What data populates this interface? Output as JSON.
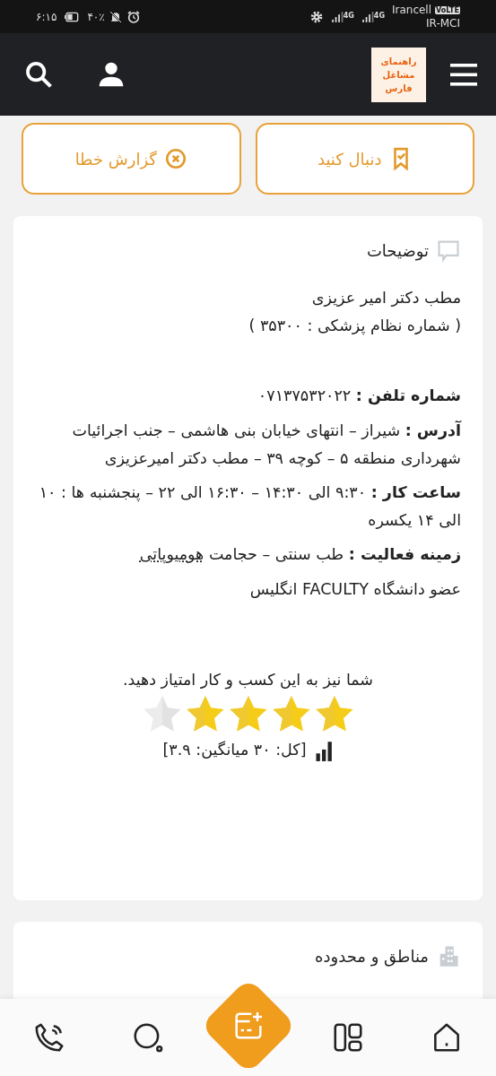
{
  "status_bar": {
    "time": "۶:۱۵",
    "battery": "۴۰٪",
    "volte": "VoLTE",
    "network_1": "4G",
    "network_2": "4G",
    "carrier_1": "Irancell",
    "carrier_2": "IR-MCI"
  },
  "header": {
    "logo_lines": [
      "راهنمای",
      "مشاغل",
      "فارس"
    ]
  },
  "actions": [
    {
      "kind": "follow",
      "label": "دنبال کنید"
    },
    {
      "kind": "report",
      "label": "گزارش خطا"
    }
  ],
  "description": {
    "title": "توضیحات",
    "lines": [
      "مطب دکتر امیر عزیزی",
      "( شماره نظام پزشکی : ۳۵۳۰۰ )"
    ],
    "fields": [
      {
        "text": "**شماره تلفن :** ۰۷۱۳۷۵۳۲۰۲۲"
      },
      {
        "text": "**آدرس :** شیراز – انتهای خیابان بنی هاشمی – جنب اجرائیات شهرداری منطقه ۵ – کوچه ۳۹ – مطب دکتر امیرعزیزی"
      },
      {
        "text": "**ساعت کار :** ۹:۳۰ الی ۱۴:۳۰ – ۱۶:۳۰ الی ۲۲ – پنجشنبه ها : ۱۰ الی ۱۴ یکسره"
      },
      {
        "text": "**زمینه فعالیت :** طب سنتی – حجامت",
        "link": "هومیوپاتی"
      },
      {
        "text": "عضو دانشگاه FACULTY انگلیس"
      }
    ],
    "rating": {
      "prompt": "شما نیز به این کسب و کار امتیاز دهید.",
      "stars": 4,
      "summary": "[کل: ۳۰ میانگین: ۳.۹]"
    }
  },
  "regions": {
    "title": "مناطق و محدوده"
  },
  "bottom_nav": [
    {
      "kind": "home"
    },
    {
      "kind": "grid"
    },
    {
      "kind": "add"
    },
    {
      "kind": "search"
    },
    {
      "kind": "call"
    }
  ]
}
